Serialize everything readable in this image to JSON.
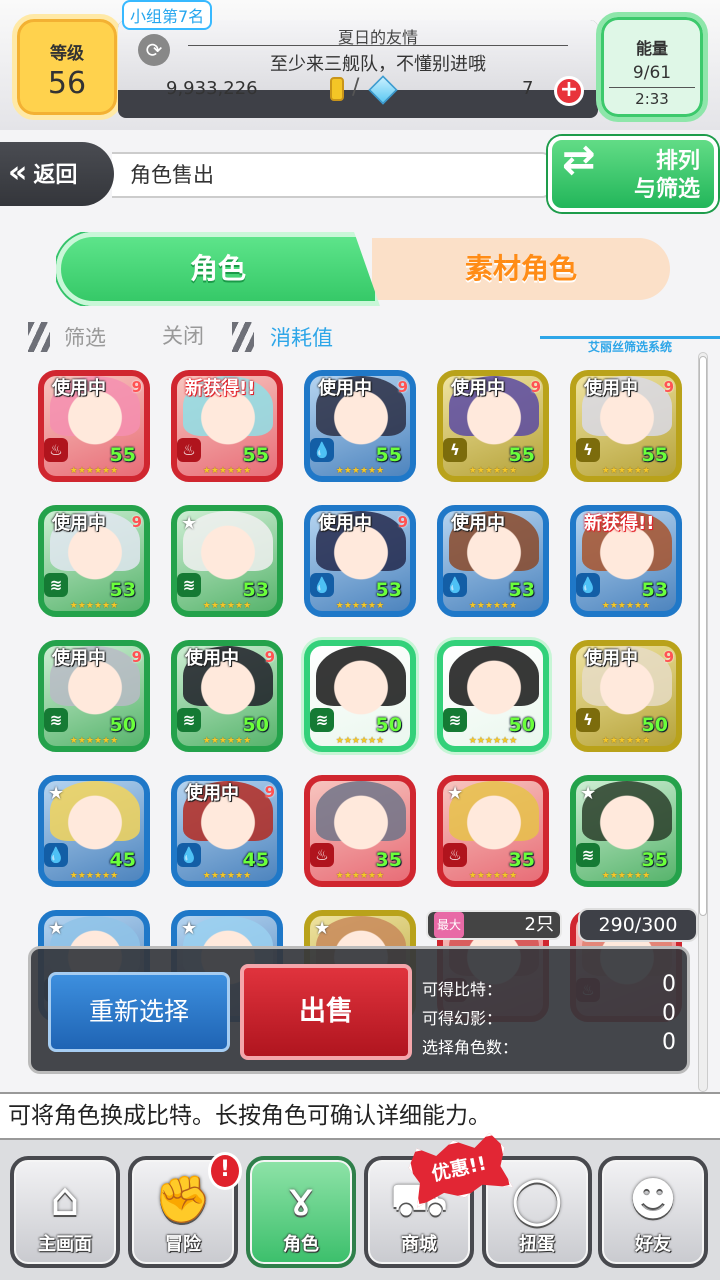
{
  "header": {
    "level_label": "等级",
    "level_value": "56",
    "group_rank": "小组第7名",
    "group_name": "夏日的友情",
    "group_message": "至少来三舰队，不懂别进哦",
    "money": "9,933,226",
    "slash": "/",
    "gems": "7",
    "plus_icon": "+",
    "energy_label": "能量",
    "energy_value": "9/61",
    "energy_timer": "2:33"
  },
  "nav": {
    "back_label": "返回",
    "back_icon": "«",
    "breadcrumb": "角色售出",
    "sort_label_1": "排列",
    "sort_label_2": "与筛选"
  },
  "tabs": {
    "characters": "角色",
    "materials": "素材角色"
  },
  "filter": {
    "filter_label": "筛选",
    "filter_value": "关闭",
    "sort_label": "消耗值",
    "system_label": "艾丽丝筛选系统"
  },
  "grid": [
    {
      "tag": "使用中",
      "sub": "9",
      "level": "55",
      "frame": "red",
      "element": "fire"
    },
    {
      "tag": "新获得!!",
      "sub": "",
      "level": "55",
      "frame": "red",
      "element": "fire"
    },
    {
      "tag": "使用中",
      "sub": "9",
      "level": "55",
      "frame": "blue",
      "element": "water"
    },
    {
      "tag": "使用中",
      "sub": "9",
      "level": "55",
      "frame": "yellow",
      "element": "thunder"
    },
    {
      "tag": "使用中",
      "sub": "9",
      "level": "55",
      "frame": "yellow",
      "element": "thunder"
    },
    {
      "tag": "使用中",
      "sub": "9",
      "level": "53",
      "frame": "green",
      "element": "wind"
    },
    {
      "tag": "",
      "sub": "",
      "level": "53",
      "frame": "green",
      "element": "wind",
      "fav": true
    },
    {
      "tag": "使用中",
      "sub": "9",
      "level": "53",
      "frame": "blue",
      "element": "water"
    },
    {
      "tag": "使用中",
      "sub": "",
      "level": "53",
      "frame": "blue",
      "element": "water"
    },
    {
      "tag": "新获得!!",
      "sub": "",
      "level": "53",
      "frame": "blue",
      "element": "water"
    },
    {
      "tag": "使用中",
      "sub": "9",
      "level": "50",
      "frame": "green",
      "element": "wind"
    },
    {
      "tag": "使用中",
      "sub": "9",
      "level": "50",
      "frame": "green",
      "element": "wind"
    },
    {
      "tag": "",
      "sub": "",
      "level": "50",
      "frame": "greenbright",
      "element": "wind"
    },
    {
      "tag": "",
      "sub": "",
      "level": "50",
      "frame": "greenbright",
      "element": "wind"
    },
    {
      "tag": "使用中",
      "sub": "9",
      "level": "50",
      "frame": "yellow",
      "element": "thunder"
    },
    {
      "tag": "",
      "sub": "",
      "level": "45",
      "frame": "blue",
      "element": "water",
      "fav": true
    },
    {
      "tag": "使用中",
      "sub": "9",
      "level": "45",
      "frame": "blue",
      "element": "water"
    },
    {
      "tag": "",
      "sub": "",
      "level": "35",
      "frame": "red",
      "element": "fire"
    },
    {
      "tag": "",
      "sub": "",
      "level": "35",
      "frame": "red",
      "element": "fire",
      "fav": true
    },
    {
      "tag": "",
      "sub": "",
      "level": "35",
      "frame": "green",
      "element": "wind",
      "fav": true
    },
    {
      "tag": "",
      "sub": "",
      "level": "",
      "frame": "blue",
      "element": "water",
      "fav": true
    },
    {
      "tag": "",
      "sub": "",
      "level": "",
      "frame": "blue",
      "element": "water",
      "fav": true
    },
    {
      "tag": "",
      "sub": "",
      "level": "",
      "frame": "yellow",
      "element": "thunder",
      "fav": true
    },
    {
      "tag": "",
      "sub": "",
      "level": "",
      "frame": "red",
      "element": "fire"
    },
    {
      "tag": "",
      "sub": "",
      "level": "",
      "frame": "red",
      "element": "fire"
    }
  ],
  "stars": "★★★★★★",
  "sell_panel": {
    "max_label": "最大",
    "max_count": "2只",
    "capacity": "290/300",
    "reselect_label": "重新选择",
    "sell_label": "出售",
    "bits_label": "可得比特：",
    "bits_value": "0",
    "phantom_label": "可得幻影：",
    "phantom_value": "0",
    "selected_label": "选择角色数：",
    "selected_value": "0"
  },
  "hint": "可将角色换成比特。长按角色可确认详细能力。",
  "bottom_nav": [
    {
      "label": "主画面",
      "icon": "home-icon"
    },
    {
      "label": "冒险",
      "icon": "handshake-icon"
    },
    {
      "label": "角色",
      "icon": "rabbit-icon"
    },
    {
      "label": "商城",
      "icon": "cart-icon"
    },
    {
      "label": "扭蛋",
      "icon": "egg-icon"
    },
    {
      "label": "好友",
      "icon": "friends-icon"
    }
  ],
  "alert_mark": "!",
  "promo_label": "优惠!!",
  "colors": {
    "red": "#d0262f",
    "blue": "#1f78c8",
    "yellow": "#b9a21a",
    "green": "#24a24b",
    "accent_green": "#36c968",
    "accent_orange": "#ff8c16"
  }
}
